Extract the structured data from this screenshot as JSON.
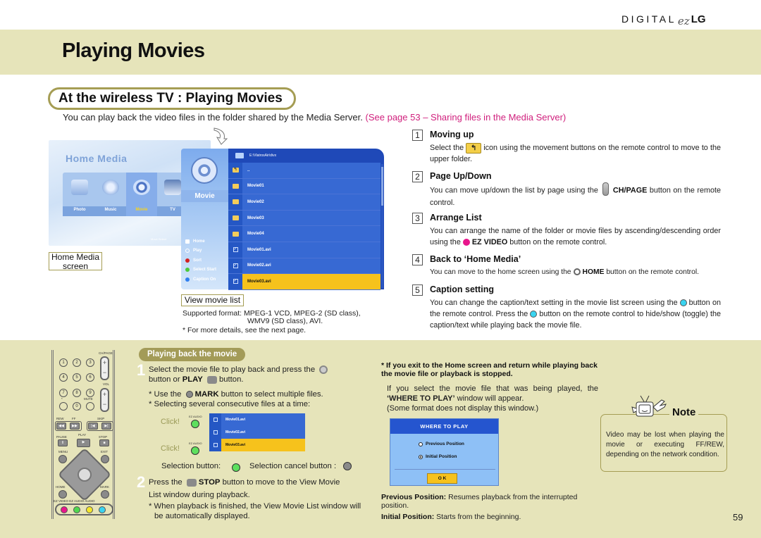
{
  "brand": {
    "prefix": "DIGITAL",
    "ez": "ez",
    "suffix": "LG"
  },
  "page_title": "Playing Movies",
  "section_title": "At the wireless TV : Playing Movies",
  "intro": {
    "text": "You can play back the video files in the folder shared by the Media Server.",
    "link": "(See page 53 – Sharing files in the Media Server)"
  },
  "home_media": {
    "title": "Home Media",
    "items": [
      {
        "label": "Photo",
        "icon": "photo-icon",
        "active": false
      },
      {
        "label": "Music",
        "icon": "music-icon",
        "active": false
      },
      {
        "label": "Movie",
        "icon": "movie-reel-icon",
        "active": true
      },
      {
        "label": "TV",
        "icon": "tv-icon",
        "active": false
      }
    ],
    "hint": "Move  Select",
    "caption": "Home Media screen"
  },
  "movie_list": {
    "category": "Movie",
    "path": "E:\\VlatrosAir\\divx",
    "menu": [
      {
        "label": "Home",
        "color": "#ffffff"
      },
      {
        "label": "Play",
        "color": "#ffffff"
      },
      {
        "label": "Sort",
        "color": "#d42020"
      },
      {
        "label": "Select Start",
        "color": "#4cc93a"
      },
      {
        "label": "Caption On",
        "color": "#2f7ff0"
      }
    ],
    "rows": [
      {
        "name": "..",
        "type": "up"
      },
      {
        "name": "Movie01",
        "type": "folder"
      },
      {
        "name": "Movie02",
        "type": "folder"
      },
      {
        "name": "Movie03",
        "type": "folder"
      },
      {
        "name": "Movie04",
        "type": "folder"
      },
      {
        "name": "Movie01.avi",
        "type": "file",
        "checked": true
      },
      {
        "name": "Movie02.avi",
        "type": "file",
        "checked": true
      },
      {
        "name": "Movie03.avi",
        "type": "file",
        "checked": true,
        "selected": true
      }
    ],
    "caption": "View movie list",
    "formats_label": "Supported format:",
    "formats_line1": "MPEG-1 VCD, MPEG-2 (SD class),",
    "formats_line2": "WMV9 (SD class), AVI.",
    "more_details": "* For more details, see the next page."
  },
  "steps": [
    {
      "num": "1",
      "title": "Moving up",
      "pre": "Select the",
      "post": "icon using the movement buttons on the remote control to move to the upper folder."
    },
    {
      "num": "2",
      "title": "Page Up/Down",
      "pre": "You can move up/down the list by page using the",
      "key": "CH/PAGE",
      "post": "button on the remote control.",
      "sup": "CH/PAGE"
    },
    {
      "num": "3",
      "title": "Arrange List",
      "pre": "You can arrange the name of the folder or movie files by ascending/descending order using the",
      "key": "EZ VIDEO",
      "post": "button on the remote control.",
      "sup": "EZ VIDEO"
    },
    {
      "num": "4",
      "title": "Back to ‘Home Media’",
      "pre": "You can move to the home screen using the",
      "key": "HOME",
      "post": "button on the remote control.",
      "sup": "HOME"
    },
    {
      "num": "5",
      "title": "Caption setting",
      "pre": "You can change the caption/text setting in the movie list screen using the",
      "mid": "button on the remote control. Press the",
      "post": "button on the remote control to hide/show (toggle) the caption/text while playing back the movie file."
    }
  ],
  "remote": {
    "numbers": [
      "1",
      "2",
      "3",
      "4",
      "5",
      "6",
      "7",
      "8",
      "9",
      "*",
      "0"
    ],
    "labels": {
      "chpage": "CH/PAGE",
      "vol": "VOL",
      "mute": "MUTE",
      "rew": "REW",
      "ff": "FF",
      "skip": "SKIP",
      "pause": "PAUSE",
      "play": "PLAY",
      "stop": "STOP",
      "menu": "MENU",
      "exit": "EXIT",
      "home": "HOME",
      "mark": "MARK",
      "colors": "EZ VIDEO EZ AUDIO AUDIO"
    },
    "color_buttons": [
      "#e8158c",
      "#4fd84f",
      "#f4e62a",
      "#3ad4f0"
    ]
  },
  "playback": {
    "title": "Playing back the movie",
    "step1_num": "1",
    "step1_a": "Select the movie file to play back and press the",
    "step1_b": "button or",
    "step1_play": "PLAY",
    "step1_c": "button.",
    "mark_pre": "* Use the",
    "mark_key": "MARK",
    "mark_post": "button to select multiple files.",
    "consecutive": "* Selecting several consecutive files at a time:",
    "click": "Click!",
    "ezaudio_sup": "EZ AUDIO",
    "mark_sup": "MARK",
    "play_sup": "PLAY",
    "stop_sup": "STOP",
    "mini_rows": [
      {
        "name": "Movie01.avi",
        "selected": false
      },
      {
        "name": "Movie02.avi",
        "selected": false
      },
      {
        "name": "Movie03.avi",
        "selected": true
      }
    ],
    "selection_button": "Selection button:",
    "cancel_button": "Selection cancel button :",
    "step2_num": "2",
    "step2_a": "Press the",
    "step2_key": "STOP",
    "step2_b": "button to move to the View Movie",
    "step2_c": "List window during playback.",
    "step2_note": "* When playback is finished, the View Movie List window will be automatically displayed."
  },
  "where_to_play": {
    "note": "* If you exit to the Home screen and return while playing back the movie file or playback is stopped.",
    "desc_a": "If you select the movie file that was being played, the",
    "desc_key": "‘WHERE TO PLAY’",
    "desc_b": "window will appear.",
    "desc_c": "(Some format does not display this window.)",
    "dialog_title": "WHERE TO PLAY",
    "options": [
      {
        "label": "Previous Position",
        "selected": false
      },
      {
        "label": "Initial Position",
        "selected": true
      }
    ],
    "ok": "O K",
    "prev_label": "Previous Position:",
    "prev_desc": "Resumes playback from the interrupted position.",
    "init_label": "Initial Position:",
    "init_desc": "Starts from the beginning."
  },
  "note": {
    "title": "Note",
    "text": "Video may be lost when playing the movie or executing FF/REW, depending on the network condition."
  },
  "page_number": "59"
}
